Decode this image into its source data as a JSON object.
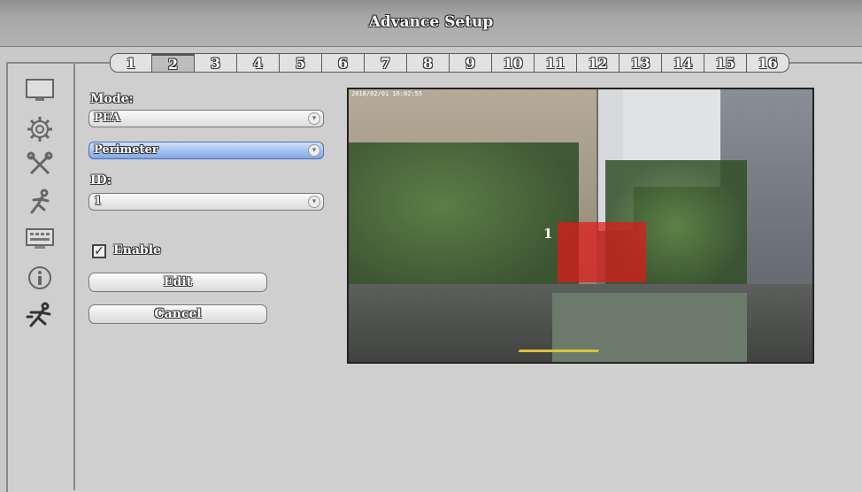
{
  "window": {
    "title": "Advance Setup"
  },
  "channels": {
    "tabs": [
      "1",
      "2",
      "3",
      "4",
      "5",
      "6",
      "7",
      "8",
      "9",
      "10",
      "11",
      "12",
      "13",
      "14",
      "15",
      "16"
    ],
    "active": "2"
  },
  "sidebar": {
    "icons": [
      "monitor-icon",
      "gear-icon",
      "tools-icon",
      "running-person-icon",
      "keyboard-icon",
      "info-icon",
      "motion-person-icon"
    ]
  },
  "form": {
    "mode_label": "Mode:",
    "mode_value": "PEA",
    "type_value": "Perimeter",
    "id_label": "ID:",
    "id_value": "1",
    "enable_label": "Enable",
    "enable_checked": true,
    "edit_label": "Edit",
    "cancel_label": "Cancel"
  },
  "preview": {
    "timestamp": "2018/02/01 16:02:55",
    "zone_label": "1",
    "zone_color": "#e11919"
  }
}
